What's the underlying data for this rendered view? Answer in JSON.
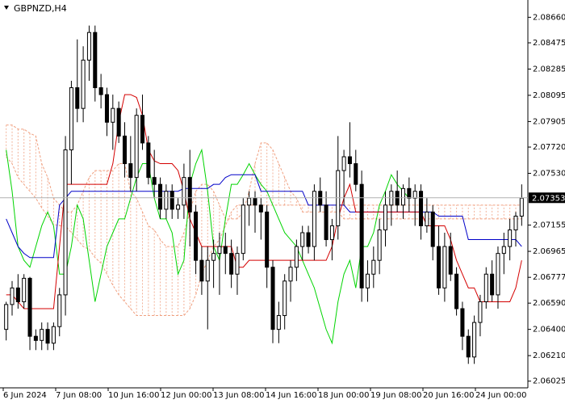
{
  "chart_data": {
    "type": "candlestick",
    "symbol_label": "GBPNZD,H4",
    "current_price_label": "2.07353",
    "y_ticks": [
      "2.08660",
      "2.08475",
      "2.08285",
      "2.08095",
      "2.07905",
      "2.07720",
      "2.07530",
      "2.07353",
      "2.07155",
      "2.06965",
      "2.06777",
      "2.06590",
      "2.06400",
      "2.06210",
      "2.06025"
    ],
    "x_ticks": [
      "6 Jun 2024",
      "7 Jun 08:00",
      "10 Jun 16:00",
      "12 Jun 00:00",
      "13 Jun 08:00",
      "14 Jun 16:00",
      "18 Jun 00:00",
      "19 Jun 08:00",
      "20 Jun 16:00",
      "24 Jun 00:00"
    ],
    "ylim": [
      2.06,
      2.0875
    ],
    "colors": {
      "up_candle": "#ffffff",
      "down_candle": "#000000",
      "wick": "#000000",
      "tenkan": "#d40000",
      "kijun": "#0000c8",
      "chikou": "#00d400",
      "cloud": "#f0a080",
      "current_price_line": "#b0b0b0",
      "current_price_box": "#000000"
    },
    "candles": [
      [
        2.064,
        2.066,
        2.0632,
        2.0658
      ],
      [
        2.0658,
        2.0675,
        2.065,
        2.067
      ],
      [
        2.067,
        2.068,
        2.0655,
        2.066
      ],
      [
        2.066,
        2.068,
        2.0655,
        2.0677
      ],
      [
        2.0677,
        2.0678,
        2.0625,
        2.0635
      ],
      [
        2.0635,
        2.064,
        2.0625,
        2.0632
      ],
      [
        2.0632,
        2.0645,
        2.0625,
        2.064
      ],
      [
        2.064,
        2.0645,
        2.0625,
        2.063
      ],
      [
        2.063,
        2.0645,
        2.0625,
        2.0642
      ],
      [
        2.0642,
        2.067,
        2.0635,
        2.0665
      ],
      [
        2.0665,
        2.078,
        2.065,
        2.077
      ],
      [
        2.077,
        2.082,
        2.0745,
        2.0815
      ],
      [
        2.0815,
        2.085,
        2.079,
        2.08
      ],
      [
        2.08,
        2.0845,
        2.079,
        2.0835
      ],
      [
        2.0835,
        2.086,
        2.082,
        2.0855
      ],
      [
        2.0855,
        2.086,
        2.0805,
        2.0815
      ],
      [
        2.0815,
        2.0825,
        2.08,
        2.081
      ],
      [
        2.081,
        2.0815,
        2.078,
        2.079
      ],
      [
        2.079,
        2.081,
        2.077,
        2.08
      ],
      [
        2.08,
        2.0805,
        2.0775,
        2.078
      ],
      [
        2.078,
        2.079,
        2.075,
        2.076
      ],
      [
        2.076,
        2.078,
        2.074,
        2.075
      ],
      [
        2.075,
        2.08,
        2.074,
        2.0795
      ],
      [
        2.0795,
        2.081,
        2.077,
        2.0775
      ],
      [
        2.0775,
        2.078,
        2.0745,
        2.075
      ],
      [
        2.075,
        2.077,
        2.0735,
        2.0745
      ],
      [
        2.0745,
        2.075,
        2.072,
        2.0727
      ],
      [
        2.0727,
        2.0745,
        2.072,
        2.074
      ],
      [
        2.074,
        2.0745,
        2.072,
        2.0727
      ],
      [
        2.0727,
        2.0735,
        2.072,
        2.073
      ],
      [
        2.073,
        2.076,
        2.072,
        2.075
      ],
      [
        2.075,
        2.077,
        2.07,
        2.0725
      ],
      [
        2.0725,
        2.073,
        2.068,
        2.069
      ],
      [
        2.069,
        2.07,
        2.0665,
        2.0675
      ],
      [
        2.0675,
        2.07,
        2.064,
        2.069
      ],
      [
        2.069,
        2.0705,
        2.067,
        2.0695
      ],
      [
        2.0695,
        2.071,
        2.0665,
        2.07
      ],
      [
        2.07,
        2.071,
        2.068,
        2.0695
      ],
      [
        2.0695,
        2.0705,
        2.067,
        2.068
      ],
      [
        2.068,
        2.07,
        2.0665,
        2.0695
      ],
      [
        2.0695,
        2.0735,
        2.069,
        2.073
      ],
      [
        2.073,
        2.074,
        2.0715,
        2.0735
      ],
      [
        2.0735,
        2.074,
        2.071,
        2.073
      ],
      [
        2.073,
        2.0735,
        2.0705,
        2.0725
      ],
      [
        2.0725,
        2.073,
        2.067,
        2.0685
      ],
      [
        2.0685,
        2.069,
        2.063,
        2.064
      ],
      [
        2.064,
        2.066,
        2.063,
        2.065
      ],
      [
        2.065,
        2.068,
        2.064,
        2.0675
      ],
      [
        2.0675,
        2.069,
        2.066,
        2.0685
      ],
      [
        2.0685,
        2.0705,
        2.0675,
        2.07
      ],
      [
        2.07,
        2.0715,
        2.069,
        2.071
      ],
      [
        2.071,
        2.0715,
        2.0695,
        2.07
      ],
      [
        2.07,
        2.0745,
        2.069,
        2.074
      ],
      [
        2.074,
        2.075,
        2.0725,
        2.073
      ],
      [
        2.073,
        2.074,
        2.07,
        2.0705
      ],
      [
        2.0705,
        2.072,
        2.069,
        2.0715
      ],
      [
        2.0715,
        2.078,
        2.0705,
        2.0755
      ],
      [
        2.0755,
        2.077,
        2.073,
        2.0765
      ],
      [
        2.0765,
        2.079,
        2.075,
        2.076
      ],
      [
        2.076,
        2.077,
        2.074,
        2.0745
      ],
      [
        2.0745,
        2.0755,
        2.066,
        2.067
      ],
      [
        2.067,
        2.069,
        2.066,
        2.068
      ],
      [
        2.068,
        2.07,
        2.067,
        2.069
      ],
      [
        2.069,
        2.072,
        2.068,
        2.0712
      ],
      [
        2.0712,
        2.074,
        2.07,
        2.073
      ],
      [
        2.073,
        2.0745,
        2.0715,
        2.074
      ],
      [
        2.074,
        2.0755,
        2.0725,
        2.073
      ],
      [
        2.073,
        2.0745,
        2.072,
        2.0742
      ],
      [
        2.0742,
        2.075,
        2.0725,
        2.0735
      ],
      [
        2.0735,
        2.0745,
        2.0715,
        2.074
      ],
      [
        2.074,
        2.0745,
        2.0705,
        2.0715
      ],
      [
        2.0715,
        2.0735,
        2.071,
        2.0725
      ],
      [
        2.0725,
        2.073,
        2.069,
        2.07
      ],
      [
        2.07,
        2.0715,
        2.0665,
        2.067
      ],
      [
        2.067,
        2.071,
        2.066,
        2.07
      ],
      [
        2.07,
        2.071,
        2.0675,
        2.068
      ],
      [
        2.068,
        2.0685,
        2.065,
        2.0655
      ],
      [
        2.0655,
        2.066,
        2.0625,
        2.0635
      ],
      [
        2.0635,
        2.064,
        2.0615,
        2.062
      ],
      [
        2.062,
        2.065,
        2.0615,
        2.0645
      ],
      [
        2.0645,
        2.0665,
        2.0635,
        2.066
      ],
      [
        2.066,
        2.0685,
        2.0655,
        2.068
      ],
      [
        2.068,
        2.069,
        2.066,
        2.0665
      ],
      [
        2.0665,
        2.07,
        2.0655,
        2.0695
      ],
      [
        2.0695,
        2.071,
        2.068,
        2.07
      ],
      [
        2.07,
        2.072,
        2.069,
        2.0712
      ],
      [
        2.0712,
        2.0725,
        2.07,
        2.0722
      ],
      [
        2.0722,
        2.0745,
        2.0715,
        2.0735
      ]
    ],
    "tenkan_sen": [
      2.0665,
      2.0665,
      2.066,
      2.0655,
      2.0655,
      2.0655,
      2.0655,
      2.0655,
      2.0655,
      2.07,
      2.0745,
      2.0745,
      2.0745,
      2.0745,
      2.0745,
      2.0745,
      2.0745,
      2.0745,
      2.076,
      2.079,
      2.081,
      2.081,
      2.0808,
      2.0795,
      2.077,
      2.0762,
      2.076,
      2.076,
      2.076,
      2.0755,
      2.074,
      2.072,
      2.071,
      2.07,
      2.07,
      2.07,
      2.07,
      2.07,
      2.07,
      2.0685,
      2.0685,
      2.069,
      2.069,
      2.069,
      2.069,
      2.069,
      2.069,
      2.069,
      2.069,
      2.069,
      2.069,
      2.069,
      2.069,
      2.069,
      2.069,
      2.07,
      2.072,
      2.0735,
      2.0745,
      2.0725,
      2.0725,
      2.0725,
      2.0725,
      2.0725,
      2.0725,
      2.0725,
      2.0725,
      2.0725,
      2.0725,
      2.0725,
      2.0725,
      2.0715,
      2.0715,
      2.0715,
      2.0715,
      2.0705,
      2.069,
      2.068,
      2.067,
      2.067,
      2.066,
      2.066,
      2.066,
      2.066,
      2.066,
      2.066,
      2.067,
      2.069
    ],
    "kijun_sen": [
      2.072,
      2.071,
      2.07,
      2.0695,
      2.0692,
      2.0692,
      2.0692,
      2.0692,
      2.0692,
      2.073,
      2.0735,
      2.074,
      2.074,
      2.074,
      2.074,
      2.074,
      2.074,
      2.074,
      2.074,
      2.074,
      2.074,
      2.074,
      2.074,
      2.074,
      2.074,
      2.074,
      2.074,
      2.074,
      2.074,
      2.074,
      2.0742,
      2.0742,
      2.0742,
      2.0742,
      2.0742,
      2.0745,
      2.0745,
      2.075,
      2.0752,
      2.0752,
      2.0752,
      2.0752,
      2.0752,
      2.074,
      2.074,
      2.074,
      2.074,
      2.074,
      2.074,
      2.074,
      2.074,
      2.073,
      2.073,
      2.073,
      2.073,
      2.073,
      2.073,
      2.073,
      2.0725,
      2.0725,
      2.0725,
      2.0725,
      2.0725,
      2.0725,
      2.0725,
      2.0725,
      2.0725,
      2.0725,
      2.0725,
      2.0725,
      2.0725,
      2.0725,
      2.0725,
      2.0722,
      2.0722,
      2.0722,
      2.0722,
      2.0722,
      2.0705,
      2.0705,
      2.0705,
      2.0705,
      2.0705,
      2.0705,
      2.0705,
      2.0705,
      2.0705,
      2.07
    ],
    "chikou_span": [
      2.077,
      2.074,
      2.07,
      2.069,
      2.0685,
      2.07,
      2.0715,
      2.0725,
      2.0715,
      2.068,
      2.068,
      2.07,
      2.073,
      2.072,
      2.069,
      2.066,
      2.068,
      2.07,
      2.071,
      2.072,
      2.072,
      2.0735,
      2.075,
      2.076,
      2.076,
      2.0735,
      2.072,
      2.072,
      2.071,
      2.068,
      2.069,
      2.0745,
      2.076,
      2.077,
      2.074,
      2.07,
      2.069,
      2.072,
      2.0745,
      2.0745,
      2.0752,
      2.076,
      2.0752,
      2.0745,
      2.074,
      2.073,
      2.072,
      2.071,
      2.0705,
      2.07,
      2.069,
      2.068,
      2.067,
      2.0655,
      2.064,
      2.063,
      2.066,
      2.068,
      2.069,
      2.067,
      2.07,
      2.07,
      2.071,
      2.073,
      2.074,
      2.0752,
      2.0745,
      2.074,
      2.0735
    ],
    "senkou_a": [
      2.0788,
      2.0788,
      2.0785,
      2.0785,
      2.0782,
      2.078,
      2.076,
      2.075,
      2.0735,
      2.073,
      2.0725,
      2.0725,
      2.073,
      2.074,
      2.075,
      2.0755,
      2.0755,
      2.0755,
      2.0755,
      2.076,
      2.076,
      2.074,
      2.0735,
      2.0725,
      2.0715,
      2.0712,
      2.0705,
      2.07,
      2.07,
      2.07,
      2.071,
      2.0725,
      2.074,
      2.0745,
      2.0745,
      2.074,
      2.073,
      2.072,
      2.072,
      2.072,
      2.0725,
      2.074,
      2.076,
      2.0775,
      2.0775,
      2.077,
      2.076,
      2.075,
      2.074,
      2.0735,
      2.0725,
      2.0725,
      2.0725,
      2.0725,
      2.0725,
      2.0725,
      2.0725,
      2.072,
      2.072,
      2.072,
      2.072,
      2.072,
      2.072,
      2.072,
      2.072,
      2.072,
      2.072,
      2.072,
      2.072,
      2.072,
      2.072,
      2.072,
      2.072,
      2.072,
      2.072,
      2.072,
      2.072,
      2.072,
      2.072,
      2.072,
      2.072,
      2.072,
      2.072,
      2.072,
      2.072,
      2.072,
      2.072,
      2.072
    ],
    "senkou_b": [
      2.0765,
      2.076,
      2.075,
      2.0745,
      2.074,
      2.0735,
      2.0728,
      2.0722,
      2.0716,
      2.0715,
      2.0715,
      2.071,
      2.0705,
      2.07,
      2.0698,
      2.0692,
      2.0688,
      2.068,
      2.0672,
      2.0665,
      2.066,
      2.0655,
      2.065,
      2.065,
      2.065,
      2.065,
      2.065,
      2.065,
      2.065,
      2.065,
      2.065,
      2.0655,
      2.0665,
      2.068,
      2.069,
      2.07,
      2.0705,
      2.0715,
      2.0725,
      2.073,
      2.073,
      2.073,
      2.073,
      2.073,
      2.073,
      2.073,
      2.073,
      2.073,
      2.073,
      2.073,
      2.073,
      2.073,
      2.073,
      2.073,
      2.073,
      2.073,
      2.073,
      2.073,
      2.073,
      2.073,
      2.073,
      2.073,
      2.073,
      2.073,
      2.073,
      2.073,
      2.073,
      2.073,
      2.073,
      2.073,
      2.073,
      2.073,
      2.073,
      2.073,
      2.073,
      2.073,
      2.073,
      2.073,
      2.073,
      2.073,
      2.073,
      2.073,
      2.073,
      2.073,
      2.073,
      2.073,
      2.073,
      2.073
    ]
  }
}
